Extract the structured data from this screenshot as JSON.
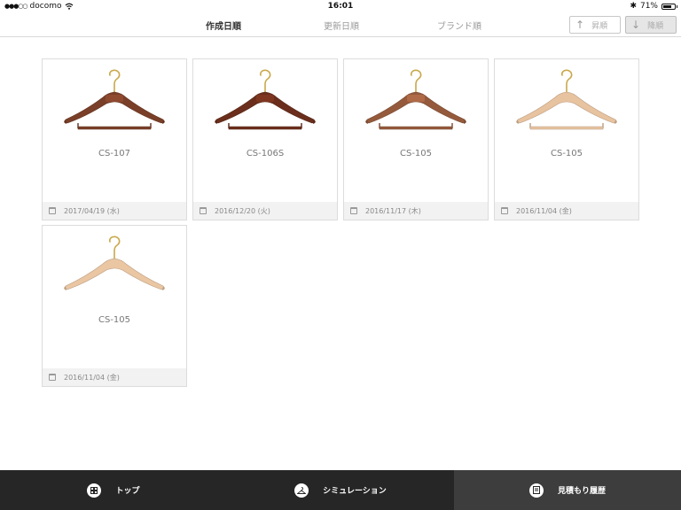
{
  "status_bar": {
    "carrier": "docomo",
    "time": "16:01",
    "battery": "71%",
    "battery_level": 0.71
  },
  "sort": {
    "tabs": [
      "作成日順",
      "更新日順",
      "ブランド順"
    ],
    "active_tab": "作成日順",
    "ascending_label": "昇順",
    "descending_label": "降順"
  },
  "items": [
    {
      "code": "CS-107",
      "date": "2017/04/19 (水)",
      "wood_color": "#7a3f28",
      "has_bar": true,
      "has_logo": true
    },
    {
      "code": "CS-106S",
      "date": "2016/12/20 (火)",
      "wood_color": "#6b2e1c",
      "has_bar": true,
      "has_logo": true
    },
    {
      "code": "CS-105",
      "date": "2016/11/17 (木)",
      "wood_color": "#955a3c",
      "has_bar": true,
      "has_logo": true
    },
    {
      "code": "CS-105",
      "date": "2016/11/04 (金)",
      "wood_color": "#e8c3a0",
      "has_bar": true,
      "has_logo": false
    },
    {
      "code": "CS-105",
      "date": "2016/11/04 (金)",
      "wood_color": "#eac6a3",
      "has_bar": false,
      "has_logo": false
    }
  ],
  "tabbar": {
    "items": [
      "トップ",
      "シミュレーション",
      "見積もり履歴"
    ],
    "icons": [
      "grid-icon",
      "hanger-icon",
      "document-icon"
    ],
    "active": "見積もり履歴"
  }
}
